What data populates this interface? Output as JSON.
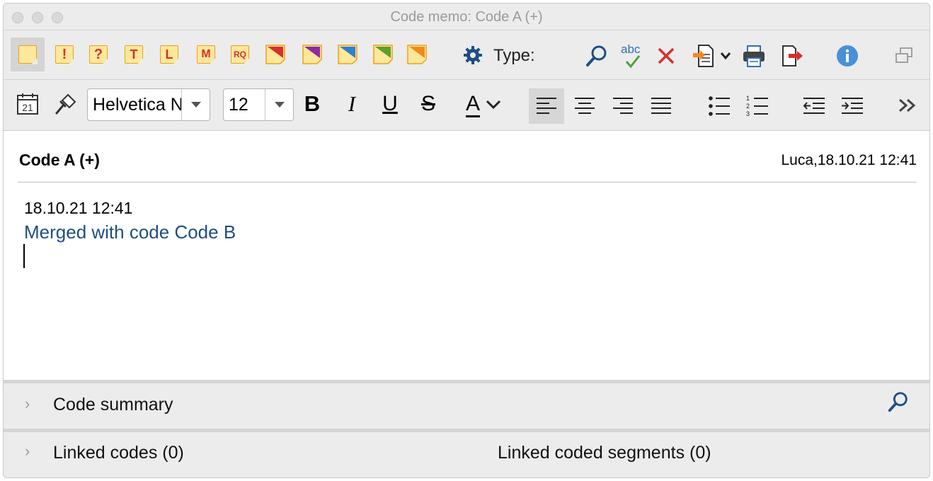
{
  "window": {
    "title": "Code memo: Code A (+)"
  },
  "toolbar": {
    "memo_types": [
      "",
      "!",
      "?",
      "T",
      "L",
      "M",
      "RQ",
      "",
      "",
      "",
      "",
      ""
    ],
    "memo_corner_colors": [
      "",
      "",
      "",
      "",
      "",
      "",
      "",
      "#d6302a",
      "#8a2aa8",
      "#2f7fd0",
      "#5aa02a",
      "#f08a1c"
    ],
    "type_label": "Type:"
  },
  "format_bar": {
    "calendar_day": "21",
    "font_family": "Helvetica Neue",
    "font_size": "12",
    "bold": "B",
    "italic": "I",
    "underline": "U",
    "strike": "S",
    "color": "A"
  },
  "memo": {
    "title": "Code A (+)",
    "author_date": "Luca,18.10.21 12:41",
    "line1": "18.10.21 12:41",
    "line2": "Merged with code Code B"
  },
  "sections": {
    "code_summary": "Code summary",
    "linked_codes": "Linked codes (0)",
    "linked_segments": "Linked coded segments (0)"
  },
  "colors": {
    "accent_blue": "#1e4e84",
    "memo_yellow": "#fde79b",
    "memo_border": "#e8a318",
    "delete_red": "#d6302a"
  }
}
